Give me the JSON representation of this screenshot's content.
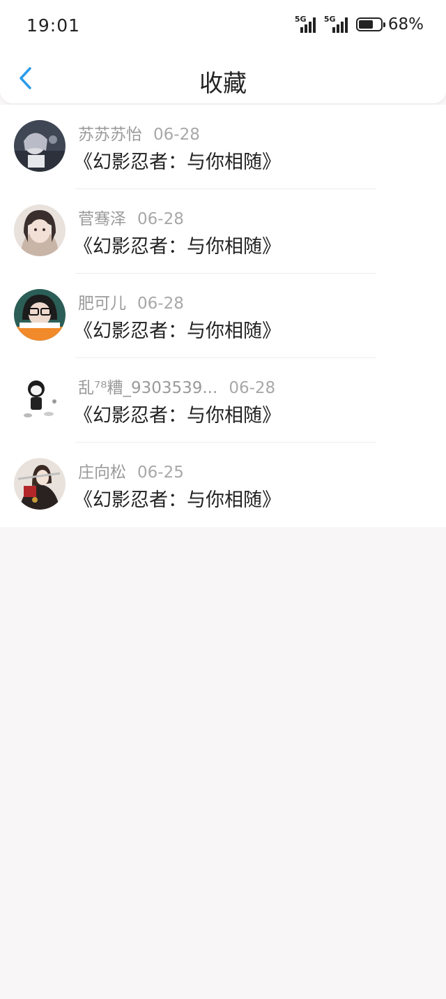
{
  "status": {
    "time": "19:01",
    "signal1_tag": "5G",
    "signal2_tag": "5G",
    "battery": "68%",
    "battery_level": 0.68
  },
  "nav": {
    "back_icon": "chevron-left-icon",
    "title": "收藏",
    "accent": "#2a9bea"
  },
  "items": [
    {
      "name": "苏苏苏怡",
      "date": "06-28",
      "title": "《幻影忍者：与你相随》"
    },
    {
      "name": "菅骞泽",
      "date": "06-28",
      "title": "《幻影忍者：与你相随》"
    },
    {
      "name": "肥可儿",
      "date": "06-28",
      "title": "《幻影忍者：与你相随》"
    },
    {
      "name": "乱⁷⁸糟_9303539...",
      "date": "06-28",
      "title": "《幻影忍者：与你相随》"
    },
    {
      "name": "庄向松",
      "date": "06-25",
      "title": "《幻影忍者：与你相随》"
    }
  ]
}
